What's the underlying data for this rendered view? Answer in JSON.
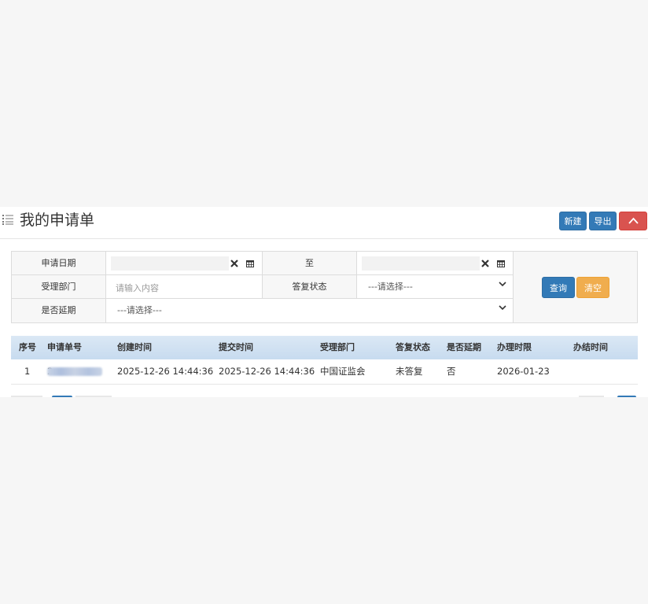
{
  "header": {
    "title": "我的申请单",
    "title_icon": "list-icon",
    "buttons": {
      "new": "新建",
      "export": "导出",
      "collapse_icon": "chevron-up-icon"
    }
  },
  "search": {
    "apply_date_label": "申请日期",
    "to_label": "至",
    "date_from_value": "",
    "date_to_value": "",
    "department_label": "受理部门",
    "department_placeholder": "请输入内容",
    "reply_status_label": "答复状态",
    "reply_status_selected": "---请选择---",
    "extended_label": "是否延期",
    "extended_selected": "---请选择---",
    "query_button": "查询",
    "clear_button": "清空"
  },
  "table": {
    "columns": [
      "序号",
      "申请单号",
      "创建时间",
      "提交时间",
      "受理部门",
      "答复状态",
      "是否延期",
      "办理时限",
      "办结时间"
    ],
    "rows": [
      {
        "index": "1",
        "number_prefix": "2",
        "created": "2025-12-26 14:44:36",
        "submitted": "2025-12-26 14:44:36",
        "department": "中国证监会",
        "reply_status": "未答复",
        "extended": "否",
        "deadline": "2026-01-23",
        "completed": ""
      }
    ]
  },
  "colors": {
    "primary": "#337ab7",
    "danger": "#d9534f",
    "warning": "#f0ad4e",
    "table_header": "#c7dbef"
  }
}
